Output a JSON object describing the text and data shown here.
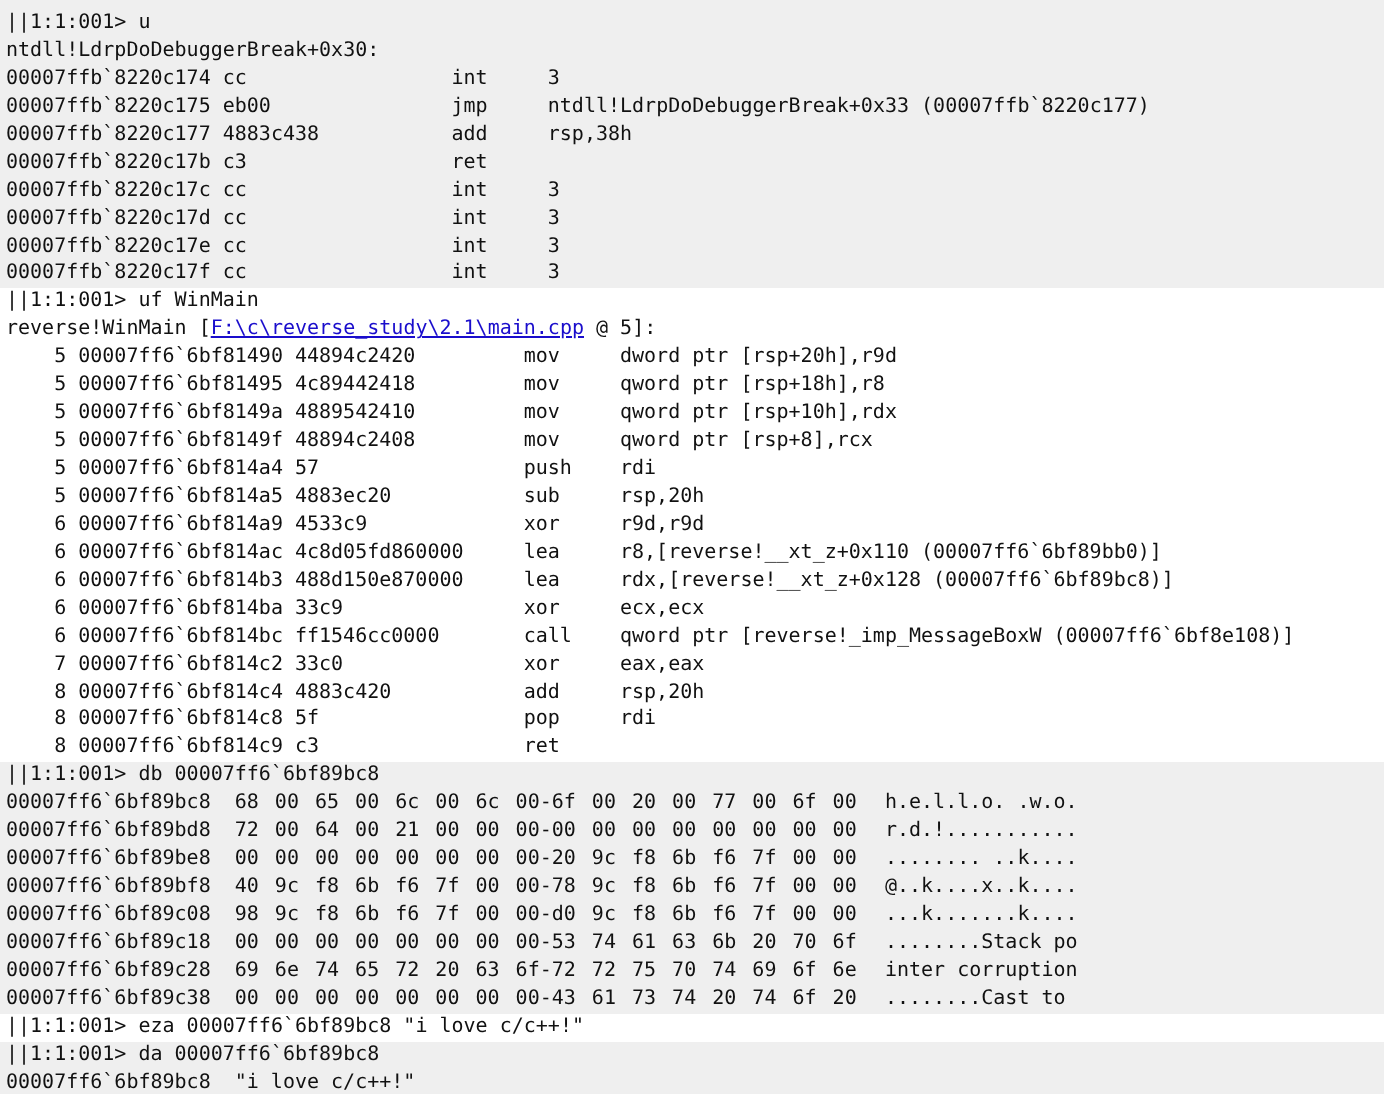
{
  "blocks": [
    {
      "kind": "disasm",
      "shaded": true,
      "command": "||1:1:001> u",
      "header": "ntdll!LdrpDoDebuggerBreak+0x30:",
      "rows": [
        {
          "address": "00007ffb`8220c174",
          "bytes": "cc",
          "mnemonic": "int",
          "operands": "3"
        },
        {
          "address": "00007ffb`8220c175",
          "bytes": "eb00",
          "mnemonic": "jmp",
          "operands": "ntdll!LdrpDoDebuggerBreak+0x33 (00007ffb`8220c177)"
        },
        {
          "address": "00007ffb`8220c177",
          "bytes": "4883c438",
          "mnemonic": "add",
          "operands": "rsp,38h"
        },
        {
          "address": "00007ffb`8220c17b",
          "bytes": "c3",
          "mnemonic": "ret"
        },
        {
          "address": "00007ffb`8220c17c",
          "bytes": "cc",
          "mnemonic": "int",
          "operands": "3"
        },
        {
          "address": "00007ffb`8220c17d",
          "bytes": "cc",
          "mnemonic": "int",
          "operands": "3"
        },
        {
          "address": "00007ffb`8220c17e",
          "bytes": "cc",
          "mnemonic": "int",
          "operands": "3"
        },
        {
          "address": "00007ffb`8220c17f",
          "bytes": "cc",
          "mnemonic": "int",
          "operands": "3"
        }
      ]
    },
    {
      "kind": "disasm",
      "shaded": false,
      "command": "||1:1:001> uf WinMain",
      "header": "reverse!WinMain [",
      "source_link": "F:\\c\\reverse_study\\2.1\\main.cpp",
      "header_end": " @ 5]:",
      "rows": [
        {
          "line": "5",
          "address": "00007ff6`6bf81490",
          "bytes": "44894c2420",
          "mnemonic": "mov",
          "operands": "dword ptr [rsp+20h],r9d"
        },
        {
          "line": "5",
          "address": "00007ff6`6bf81495",
          "bytes": "4c89442418",
          "mnemonic": "mov",
          "operands": "qword ptr [rsp+18h],r8"
        },
        {
          "line": "5",
          "address": "00007ff6`6bf8149a",
          "bytes": "4889542410",
          "mnemonic": "mov",
          "operands": "qword ptr [rsp+10h],rdx"
        },
        {
          "line": "5",
          "address": "00007ff6`6bf8149f",
          "bytes": "48894c2408",
          "mnemonic": "mov",
          "operands": "qword ptr [rsp+8],rcx"
        },
        {
          "line": "5",
          "address": "00007ff6`6bf814a4",
          "bytes": "57",
          "mnemonic": "push",
          "operands": "rdi"
        },
        {
          "line": "5",
          "address": "00007ff6`6bf814a5",
          "bytes": "4883ec20",
          "mnemonic": "sub",
          "operands": "rsp,20h"
        },
        {
          "line": "6",
          "address": "00007ff6`6bf814a9",
          "bytes": "4533c9",
          "mnemonic": "xor",
          "operands": "r9d,r9d"
        },
        {
          "line": "6",
          "address": "00007ff6`6bf814ac",
          "bytes": "4c8d05fd860000",
          "mnemonic": "lea",
          "operands": "r8,[reverse!__xt_z+0x110 (00007ff6`6bf89bb0)]"
        },
        {
          "line": "6",
          "address": "00007ff6`6bf814b3",
          "bytes": "488d150e870000",
          "mnemonic": "lea",
          "operands": "rdx,[reverse!__xt_z+0x128 (00007ff6`6bf89bc8)]"
        },
        {
          "line": "6",
          "address": "00007ff6`6bf814ba",
          "bytes": "33c9",
          "mnemonic": "xor",
          "operands": "ecx,ecx"
        },
        {
          "line": "6",
          "address": "00007ff6`6bf814bc",
          "bytes": "ff1546cc0000",
          "mnemonic": "call",
          "operands": "qword ptr [reverse!_imp_MessageBoxW (00007ff6`6bf8e108)]"
        },
        {
          "line": "7",
          "address": "00007ff6`6bf814c2",
          "bytes": "33c0",
          "mnemonic": "xor",
          "operands": "eax,eax"
        },
        {
          "line": "8",
          "address": "00007ff6`6bf814c4",
          "bytes": "4883c420",
          "mnemonic": "add",
          "operands": "rsp,20h"
        },
        {
          "line": "8",
          "address": "00007ff6`6bf814c8",
          "bytes": "5f",
          "mnemonic": "pop",
          "operands": "rdi"
        },
        {
          "line": "8",
          "address": "00007ff6`6bf814c9",
          "bytes": "c3",
          "mnemonic": "ret"
        }
      ]
    },
    {
      "kind": "memory",
      "shaded": true,
      "command": "||1:1:001> db 00007ff6`6bf89bc8",
      "rows": [
        {
          "address": "00007ff6`6bf89bc8",
          "hex": "68 00 65 00 6c 00 6c 00-6f 00 20 00 77 00 6f 00",
          "ascii": "h.e.l.l.o. .w.o."
        },
        {
          "address": "00007ff6`6bf89bd8",
          "hex": "72 00 64 00 21 00 00 00-00 00 00 00 00 00 00 00",
          "ascii": "r.d.!..........."
        },
        {
          "address": "00007ff6`6bf89be8",
          "hex": "00 00 00 00 00 00 00 00-20 9c f8 6b f6 7f 00 00",
          "ascii": "........ ..k...."
        },
        {
          "address": "00007ff6`6bf89bf8",
          "hex": "40 9c f8 6b f6 7f 00 00-78 9c f8 6b f6 7f 00 00",
          "ascii": "@..k....x..k...."
        },
        {
          "address": "00007ff6`6bf89c08",
          "hex": "98 9c f8 6b f6 7f 00 00-d0 9c f8 6b f6 7f 00 00",
          "ascii": "...k.......k...."
        },
        {
          "address": "00007ff6`6bf89c18",
          "hex": "00 00 00 00 00 00 00 00-53 74 61 63 6b 20 70 6f",
          "ascii": "........Stack po"
        },
        {
          "address": "00007ff6`6bf89c28",
          "hex": "69 6e 74 65 72 20 63 6f-72 72 75 70 74 69 6f 6e",
          "ascii": "inter corruption"
        },
        {
          "address": "00007ff6`6bf89c38",
          "hex": "00 00 00 00 00 00 00 00-43 61 73 74 20 74 6f 20",
          "ascii": "........Cast to"
        }
      ]
    },
    {
      "kind": "command",
      "shaded": false,
      "command": "||1:1:001> eza 00007ff6`6bf89bc8 \"i love c/c++!\""
    },
    {
      "kind": "strings",
      "shaded": true,
      "command": "||1:1:001> da 00007ff6`6bf89bc8",
      "rows": [
        {
          "address": "00007ff6`6bf89bc8",
          "text": "\"i love c/c++!\""
        }
      ]
    }
  ]
}
